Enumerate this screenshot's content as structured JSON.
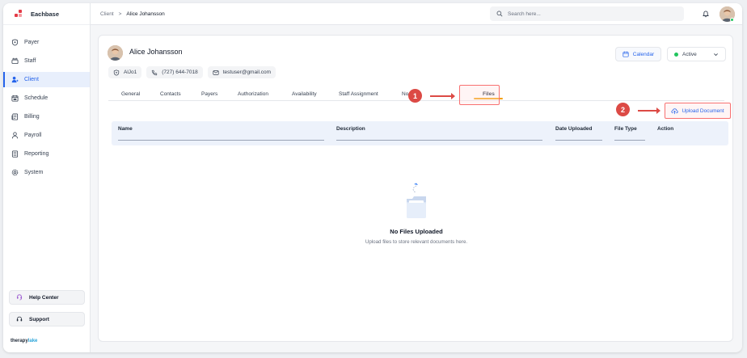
{
  "app": {
    "brand": "Eachbase",
    "footer_logo_left": "therapy",
    "footer_logo_right": "lake"
  },
  "breadcrumb": {
    "parent": "Client",
    "separator": ">",
    "current": "Alice Johansson"
  },
  "search": {
    "placeholder": "Search here..."
  },
  "sidebar": {
    "items": [
      {
        "label": "Payer",
        "icon": "shield-icon",
        "active": false
      },
      {
        "label": "Staff",
        "icon": "staff-icon",
        "active": false
      },
      {
        "label": "Client",
        "icon": "client-icon",
        "active": true
      },
      {
        "label": "Schedule",
        "icon": "calendar-icon",
        "active": false
      },
      {
        "label": "Billing",
        "icon": "billing-icon",
        "active": false
      },
      {
        "label": "Payroll",
        "icon": "payroll-icon",
        "active": false
      },
      {
        "label": "Reporting",
        "icon": "report-icon",
        "active": false
      },
      {
        "label": "System",
        "icon": "gear-icon",
        "active": false
      }
    ],
    "help_center": "Help Center",
    "support": "Support"
  },
  "client": {
    "name": "Alice Johansson",
    "id": "AlJo1",
    "phone": "(727) 644-7018",
    "email": "testuser@gmail.com",
    "calendar_label": "Calendar",
    "status": "Active"
  },
  "tabs": [
    {
      "label": "General"
    },
    {
      "label": "Contacts"
    },
    {
      "label": "Payers"
    },
    {
      "label": "Authorization"
    },
    {
      "label": "Availability"
    },
    {
      "label": "Staff Assignment"
    },
    {
      "label": "No"
    },
    {
      "label": "Files",
      "active": true
    }
  ],
  "annotations": {
    "step1": "1",
    "step2": "2"
  },
  "upload_label": "Upload Document",
  "table": {
    "columns": [
      "Name",
      "Description",
      "Date Uploaded",
      "File Type",
      "Action"
    ]
  },
  "empty_state": {
    "title": "No Files Uploaded",
    "subtitle": "Upload files to store relevant documents here."
  },
  "colors": {
    "accent": "#2563eb",
    "active_tab": "#f59e0b",
    "annotation": "#dc4a45",
    "status_active": "#22c55e"
  }
}
